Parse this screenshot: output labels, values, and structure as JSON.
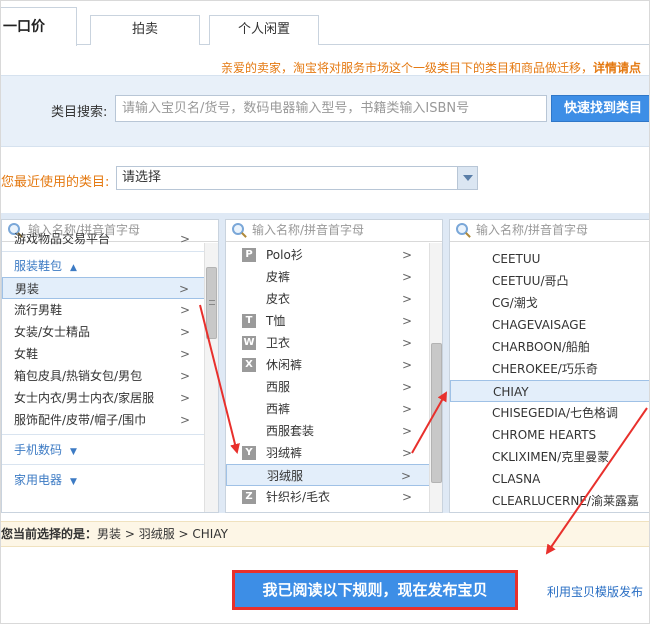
{
  "tabs": [
    {
      "label": "一口价",
      "active": true
    },
    {
      "label": "拍卖"
    },
    {
      "label": "个人闲置"
    }
  ],
  "notice": {
    "text": "亲爱的卖家，淘宝将对服务市场这个一级类目下的类目和商品做迁移，",
    "link": "详情请点"
  },
  "search": {
    "label": "类目搜索:",
    "placeholder": "请输入宝贝名/货号，数码电器输入型号，书籍类输入ISBN号",
    "button": "快速找到类目"
  },
  "recent": {
    "label": "您最近使用的类目:",
    "value": "请选择"
  },
  "column_search_placeholder": "输入名称/拼音首字母",
  "col1": {
    "partial_top": "游戏物品交易平台",
    "group1": "服装鞋包",
    "items": [
      "男装",
      "流行男鞋",
      "女装/女士精品",
      "女鞋",
      "箱包皮具/热销女包/男包",
      "女士内衣/男士内衣/家居服",
      "服饰配件/皮带/帽子/围巾"
    ],
    "group2": "手机数码",
    "group3": "家用电器"
  },
  "col2": {
    "items": [
      {
        "letter": "P",
        "label": "Polo衫"
      },
      {
        "letter": "",
        "label": "皮裤"
      },
      {
        "letter": "",
        "label": "皮衣"
      },
      {
        "letter": "T",
        "label": "T恤"
      },
      {
        "letter": "W",
        "label": "卫衣"
      },
      {
        "letter": "X",
        "label": "休闲裤"
      },
      {
        "letter": "",
        "label": "西服"
      },
      {
        "letter": "",
        "label": "西裤"
      },
      {
        "letter": "",
        "label": "西服套装"
      },
      {
        "letter": "Y",
        "label": "羽绒裤"
      },
      {
        "letter": "",
        "label": "羽绒服"
      },
      {
        "letter": "Z",
        "label": "针织衫/毛衣"
      }
    ]
  },
  "col3": {
    "items": [
      "CEETUU",
      "CEETUU/哥凸",
      "CG/潮戈",
      "CHAGEVAISAGE",
      "CHARBOON/船舶",
      "CHEROKEE/巧乐奇",
      "CHIAY",
      "CHISEGEDIA/七色格调",
      "CHROME HEARTS",
      "CKLIXIMEN/克里曼蒙",
      "CLASNA",
      "CLEARLUCERNE/渝莱露嘉"
    ]
  },
  "current_path": {
    "label": "您当前选择的是：",
    "path": "男装 > 羽绒服 > CHIAY"
  },
  "publish_button": "我已阅读以下规则，现在发布宝贝",
  "template_link": "利用宝贝模版发布",
  "colors": {
    "accent_blue": "#3d8ee6",
    "highlight_red": "#e8302c",
    "notice_orange": "#e47911"
  }
}
